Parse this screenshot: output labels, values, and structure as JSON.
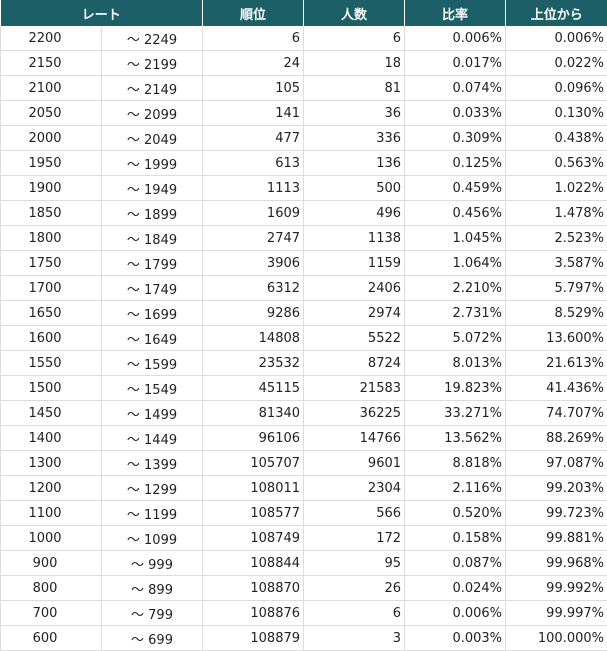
{
  "table": {
    "headers": {
      "rate": "レート",
      "rank": "順位",
      "count": "人数",
      "ratio": "比率",
      "cumulative": "上位から"
    },
    "rows": [
      {
        "from": "2200",
        "to": "～ 2249",
        "rank": "6",
        "count": "6",
        "ratio": "0.006%",
        "cumulative": "0.006%"
      },
      {
        "from": "2150",
        "to": "～ 2199",
        "rank": "24",
        "count": "18",
        "ratio": "0.017%",
        "cumulative": "0.022%"
      },
      {
        "from": "2100",
        "to": "～ 2149",
        "rank": "105",
        "count": "81",
        "ratio": "0.074%",
        "cumulative": "0.096%"
      },
      {
        "from": "2050",
        "to": "～ 2099",
        "rank": "141",
        "count": "36",
        "ratio": "0.033%",
        "cumulative": "0.130%"
      },
      {
        "from": "2000",
        "to": "～ 2049",
        "rank": "477",
        "count": "336",
        "ratio": "0.309%",
        "cumulative": "0.438%"
      },
      {
        "from": "1950",
        "to": "～ 1999",
        "rank": "613",
        "count": "136",
        "ratio": "0.125%",
        "cumulative": "0.563%"
      },
      {
        "from": "1900",
        "to": "～ 1949",
        "rank": "1113",
        "count": "500",
        "ratio": "0.459%",
        "cumulative": "1.022%"
      },
      {
        "from": "1850",
        "to": "～ 1899",
        "rank": "1609",
        "count": "496",
        "ratio": "0.456%",
        "cumulative": "1.478%"
      },
      {
        "from": "1800",
        "to": "～ 1849",
        "rank": "2747",
        "count": "1138",
        "ratio": "1.045%",
        "cumulative": "2.523%"
      },
      {
        "from": "1750",
        "to": "～ 1799",
        "rank": "3906",
        "count": "1159",
        "ratio": "1.064%",
        "cumulative": "3.587%"
      },
      {
        "from": "1700",
        "to": "～ 1749",
        "rank": "6312",
        "count": "2406",
        "ratio": "2.210%",
        "cumulative": "5.797%"
      },
      {
        "from": "1650",
        "to": "～ 1699",
        "rank": "9286",
        "count": "2974",
        "ratio": "2.731%",
        "cumulative": "8.529%"
      },
      {
        "from": "1600",
        "to": "～ 1649",
        "rank": "14808",
        "count": "5522",
        "ratio": "5.072%",
        "cumulative": "13.600%"
      },
      {
        "from": "1550",
        "to": "～ 1599",
        "rank": "23532",
        "count": "8724",
        "ratio": "8.013%",
        "cumulative": "21.613%"
      },
      {
        "from": "1500",
        "to": "～ 1549",
        "rank": "45115",
        "count": "21583",
        "ratio": "19.823%",
        "cumulative": "41.436%"
      },
      {
        "from": "1450",
        "to": "～ 1499",
        "rank": "81340",
        "count": "36225",
        "ratio": "33.271%",
        "cumulative": "74.707%"
      },
      {
        "from": "1400",
        "to": "～ 1449",
        "rank": "96106",
        "count": "14766",
        "ratio": "13.562%",
        "cumulative": "88.269%"
      },
      {
        "from": "1300",
        "to": "～ 1399",
        "rank": "105707",
        "count": "9601",
        "ratio": "8.818%",
        "cumulative": "97.087%"
      },
      {
        "from": "1200",
        "to": "～ 1299",
        "rank": "108011",
        "count": "2304",
        "ratio": "2.116%",
        "cumulative": "99.203%"
      },
      {
        "from": "1100",
        "to": "～ 1199",
        "rank": "108577",
        "count": "566",
        "ratio": "0.520%",
        "cumulative": "99.723%"
      },
      {
        "from": "1000",
        "to": "～ 1099",
        "rank": "108749",
        "count": "172",
        "ratio": "0.158%",
        "cumulative": "99.881%"
      },
      {
        "from": "900",
        "to": "～ 999",
        "rank": "108844",
        "count": "95",
        "ratio": "0.087%",
        "cumulative": "99.968%"
      },
      {
        "from": "800",
        "to": "～ 899",
        "rank": "108870",
        "count": "26",
        "ratio": "0.024%",
        "cumulative": "99.992%"
      },
      {
        "from": "700",
        "to": "～ 799",
        "rank": "108876",
        "count": "6",
        "ratio": "0.006%",
        "cumulative": "99.997%"
      },
      {
        "from": "600",
        "to": "～ 699",
        "rank": "108879",
        "count": "3",
        "ratio": "0.003%",
        "cumulative": "100.000%"
      }
    ]
  },
  "colors": {
    "header_bg": "#1d5f66",
    "header_text": "#ffffff",
    "grid_line": "#dcdcdc"
  }
}
